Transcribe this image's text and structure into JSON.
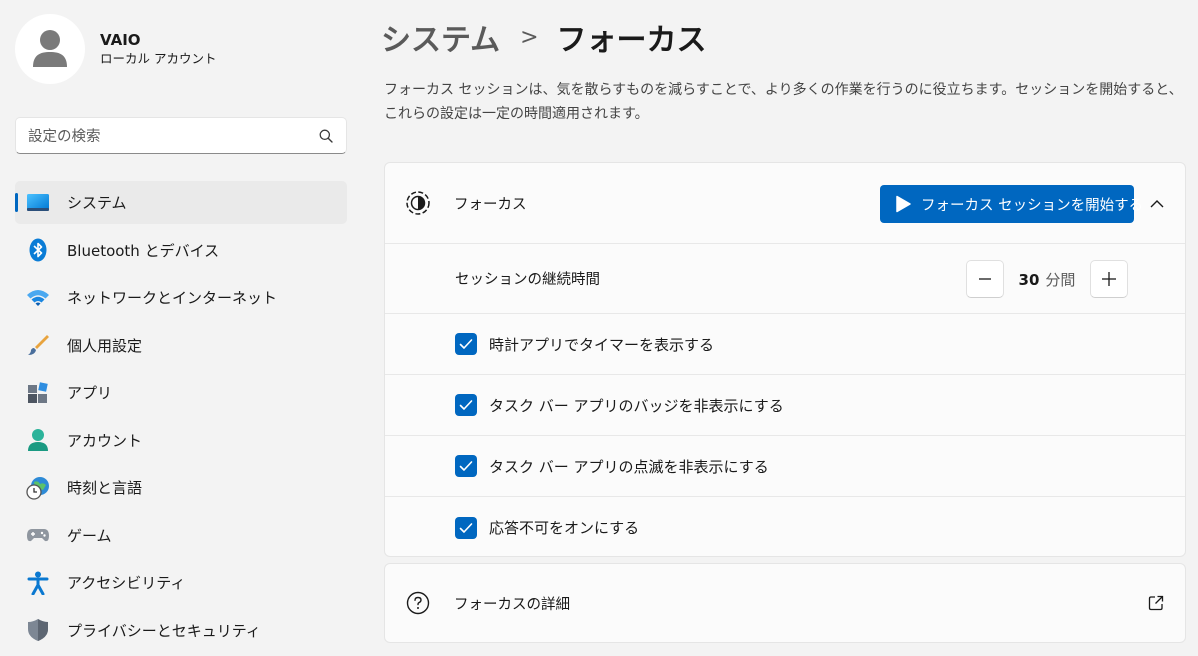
{
  "profile": {
    "name": "VAIO",
    "account_type": "ローカル アカウント"
  },
  "search": {
    "placeholder": "設定の検索"
  },
  "sidebar": {
    "items": [
      {
        "label": "システム",
        "icon": "system-display-icon",
        "active": true
      },
      {
        "label": "Bluetooth とデバイス",
        "icon": "bluetooth-icon"
      },
      {
        "label": "ネットワークとインターネット",
        "icon": "wifi-icon"
      },
      {
        "label": "個人用設定",
        "icon": "paintbrush-icon"
      },
      {
        "label": "アプリ",
        "icon": "apps-icon"
      },
      {
        "label": "アカウント",
        "icon": "account-icon"
      },
      {
        "label": "時刻と言語",
        "icon": "time-language-icon"
      },
      {
        "label": "ゲーム",
        "icon": "gamepad-icon"
      },
      {
        "label": "アクセシビリティ",
        "icon": "accessibility-icon"
      },
      {
        "label": "プライバシーとセキュリティ",
        "icon": "shield-icon"
      }
    ]
  },
  "breadcrumb": {
    "parent": "システム",
    "separator": ">",
    "current": "フォーカス"
  },
  "description": "フォーカス セッションは、気を散らすものを減らすことで、より多くの作業を行うのに役立ちます。セッションを開始すると、これらの設定は一定の時間適用されます。",
  "focus": {
    "title": "フォーカス",
    "start_button": "フォーカス セッションを開始する",
    "expanded": true,
    "duration_label": "セッションの継続時間",
    "duration_value": "30",
    "duration_unit": "分間",
    "options": [
      {
        "label": "時計アプリでタイマーを表示する",
        "checked": true
      },
      {
        "label": "タスク バー アプリのバッジを非表示にする",
        "checked": true
      },
      {
        "label": "タスク バー アプリの点滅を非表示にする",
        "checked": true
      },
      {
        "label": "応答不可をオンにする",
        "checked": true
      }
    ]
  },
  "details": {
    "label": "フォーカスの詳細"
  },
  "colors": {
    "accent": "#0067c0",
    "background": "#f3f3f3",
    "card": "#fbfbfb"
  }
}
